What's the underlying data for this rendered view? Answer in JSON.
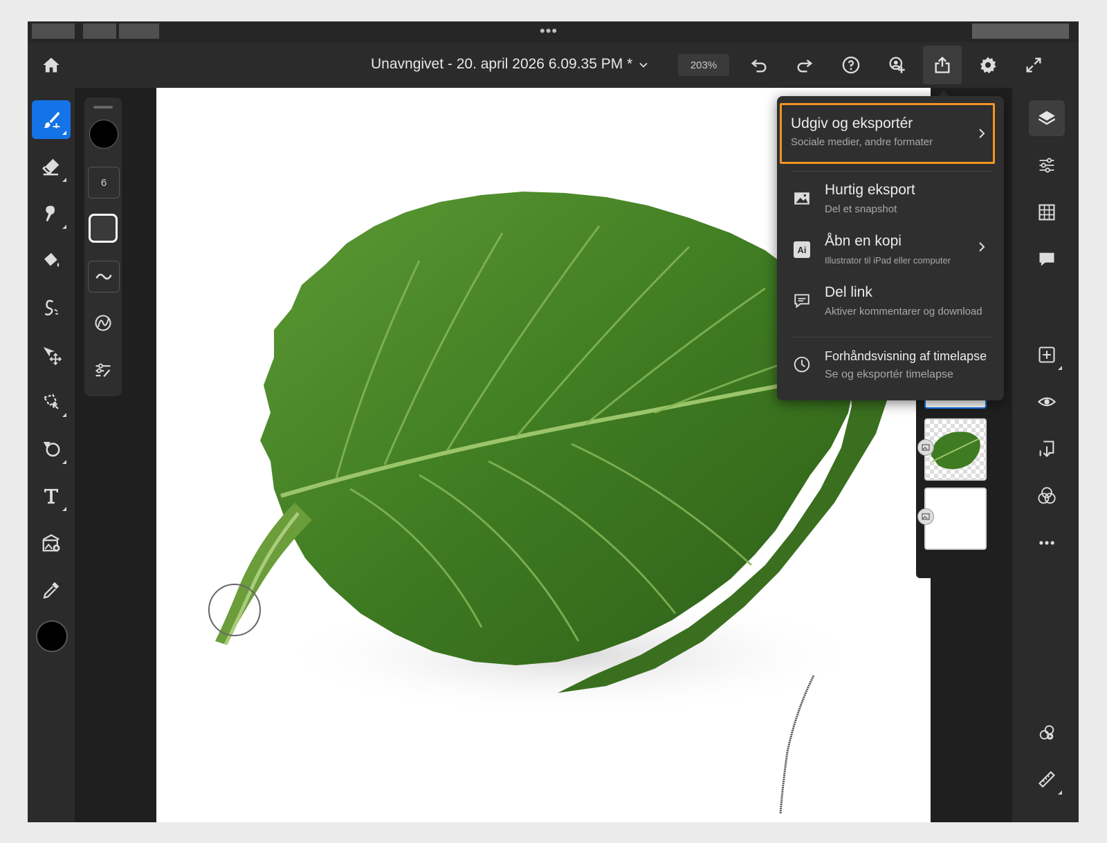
{
  "app": {
    "document_title": "Unavngivet - 20. april 2026 6.09.35 PM *",
    "zoom": "203%"
  },
  "topbar_icons": [
    "home-icon",
    "chevron-down-icon",
    "undo-icon",
    "redo-icon",
    "help-icon",
    "invite-icon",
    "share-icon",
    "gear-icon",
    "fullscreen-icon"
  ],
  "left_tools": [
    "brush-icon",
    "eraser-icon",
    "smudge-icon",
    "fill-icon",
    "liquify-icon",
    "move-icon",
    "lasso-icon",
    "shape-icon",
    "type-icon",
    "place-image-icon",
    "eyedropper-icon"
  ],
  "brush_panel": {
    "size": "6"
  },
  "right_tools": [
    "layers-icon",
    "adjustments-icon",
    "grid-icon",
    "comment-icon",
    "add-layer-icon",
    "visibility-icon",
    "import-icon",
    "blend-icon",
    "more-icon",
    "history-icon",
    "ruler-icon"
  ],
  "share_menu": {
    "items": [
      {
        "title": "Udgiv og eksportér",
        "subtitle": "Sociale medier, andre formater",
        "icon": "none",
        "has_submenu": true,
        "highlighted": true
      },
      {
        "title": "Hurtig eksport",
        "subtitle": "Del et snapshot",
        "icon": "image-icon",
        "has_submenu": false
      },
      {
        "title": "Åbn en kopi",
        "subtitle": "Illustrator til iPad eller computer",
        "icon": "ai-icon",
        "has_submenu": true
      },
      {
        "title": "Del link",
        "subtitle": "Aktiver kommentarer og download",
        "icon": "comment-icon",
        "has_submenu": false
      },
      {
        "title": "Forhåndsvisning af timelapse",
        "subtitle": "Se og eksportér timelapse",
        "icon": "clock-icon",
        "has_submenu": false
      }
    ],
    "ai_badge": "Ai"
  },
  "colors": {
    "accent": "#1473e6",
    "highlight": "#f29423",
    "leaf": "#4e8a2a"
  }
}
